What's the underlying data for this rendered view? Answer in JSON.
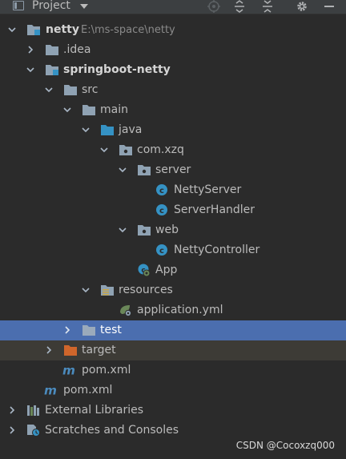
{
  "toolbar": {
    "title": "Project",
    "icons": [
      "locate-icon",
      "expand-all-icon",
      "collapse-all-icon",
      "gear-icon",
      "hide-icon"
    ]
  },
  "tree": {
    "netty": {
      "label": "netty",
      "path": "E:\\ms-space\\netty"
    },
    "idea": "idea",
    "springboot_netty": "springboot-netty",
    "src": "src",
    "main": "main",
    "java": "java",
    "com_xzq": "com.xzq",
    "server": "server",
    "netty_server": "NettyServer",
    "server_handler": "ServerHandler",
    "web": "web",
    "netty_controller": "NettyController",
    "app": "App",
    "resources": "resources",
    "application_yml": "application.yml",
    "test": "test",
    "target": "target",
    "pom_inner": "pom.xml",
    "pom_outer": "pom.xml",
    "external_libraries": "External Libraries",
    "scratches": "Scratches and Consoles"
  },
  "watermark": "CSDN @Cocoxzq000",
  "colors": {
    "background": "#2b2b2b",
    "selection": "#4b6eaf",
    "excluded": "#3d3b36",
    "folder": "#8fa2b3",
    "source_folder": "#3592c4",
    "excluded_folder": "#d0662b",
    "class_icon": "#3592c4",
    "maven": "#4b8bbe"
  }
}
